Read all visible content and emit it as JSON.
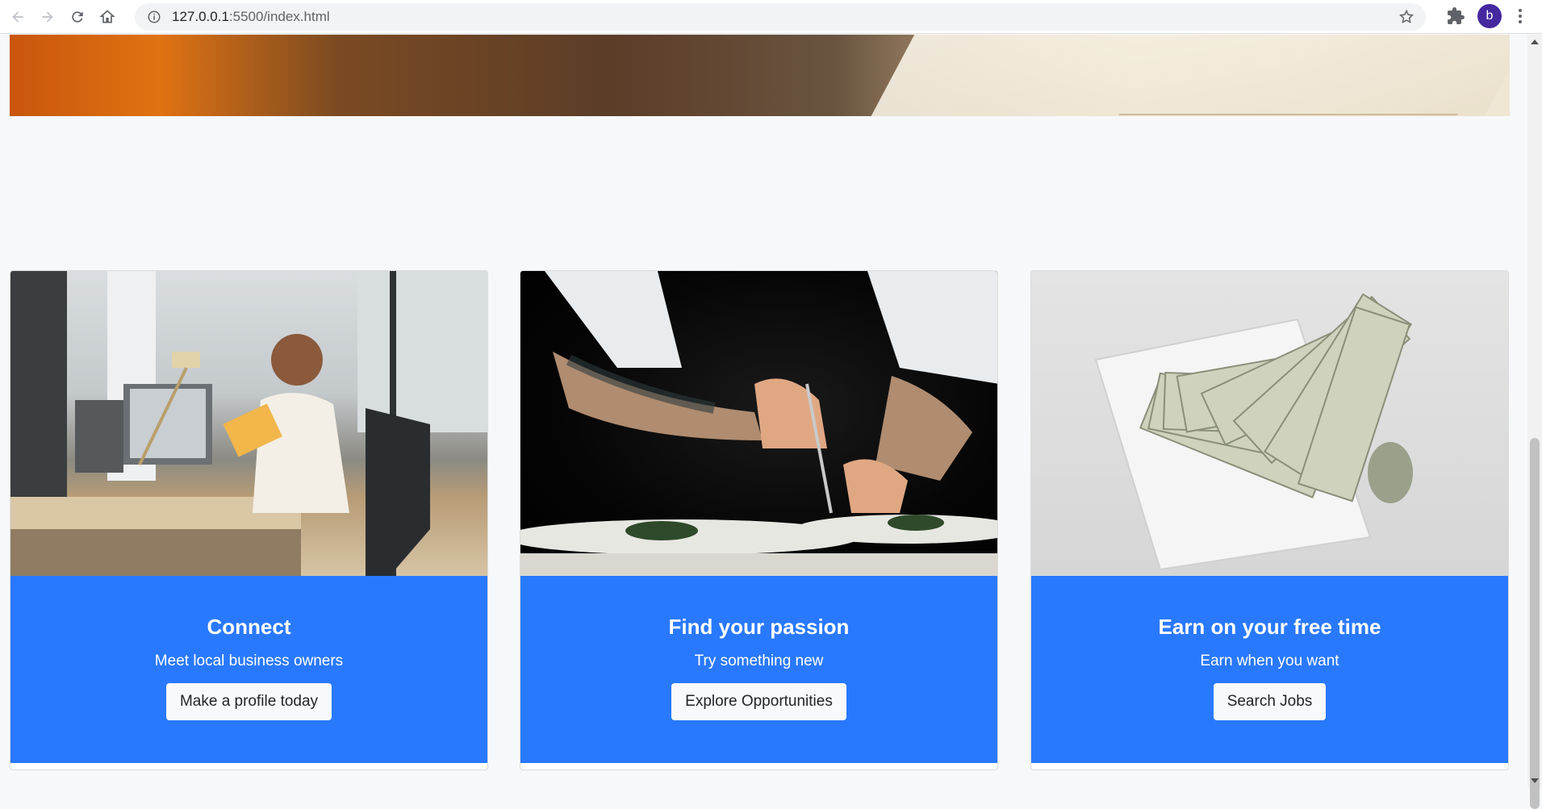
{
  "browser": {
    "url_host": "127.0.0.1",
    "url_rest": ":5500/index.html",
    "profile_initial": "b"
  },
  "cards": [
    {
      "title": "Connect",
      "subtitle": "Meet local business owners",
      "button": "Make a profile today",
      "image": "office-worker-reading"
    },
    {
      "title": "Find your passion",
      "subtitle": "Try something new",
      "button": "Explore Opportunities",
      "image": "chef-plating-food"
    },
    {
      "title": "Earn on your free time",
      "subtitle": "Earn when you want",
      "button": "Search Jobs",
      "image": "dollar-bills-envelope"
    }
  ],
  "colors": {
    "card_accent": "#2979ff",
    "button_bg": "#f8f9fa",
    "page_bg": "#f7f8fa"
  }
}
